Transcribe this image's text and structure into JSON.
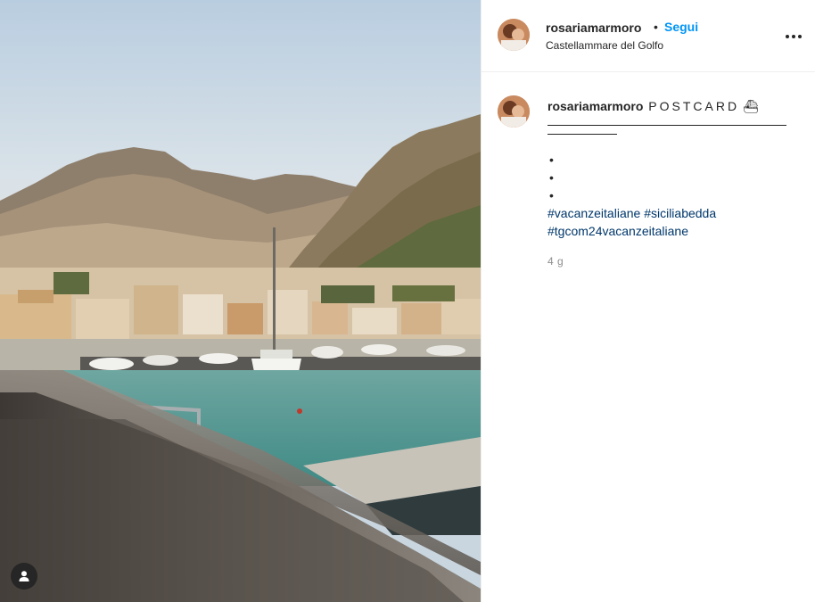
{
  "post": {
    "author": {
      "username": "rosariamarmoro",
      "separator": "•",
      "follow_label": "Segui",
      "location": "Castellammare del Golfo"
    },
    "more_icon": "more-horizontal-icon",
    "caption": {
      "username": "rosariamarmoro",
      "title": "POSTCARD",
      "title_emoji": "⛴",
      "bullets": [
        "•",
        "•",
        "•"
      ],
      "hashtags": [
        "#vacanzeitaliane",
        "#siciliabedda",
        "#tgcom24vacanzeitaliane"
      ]
    },
    "timestamp": "4 g",
    "photo": {
      "user_tag_icon": "user-icon"
    }
  },
  "colors": {
    "follow_blue": "#0095f6",
    "hashtag_blue": "#00376b",
    "muted_gray": "#8e8e8e",
    "text": "#262626",
    "divider": "#efefef"
  }
}
